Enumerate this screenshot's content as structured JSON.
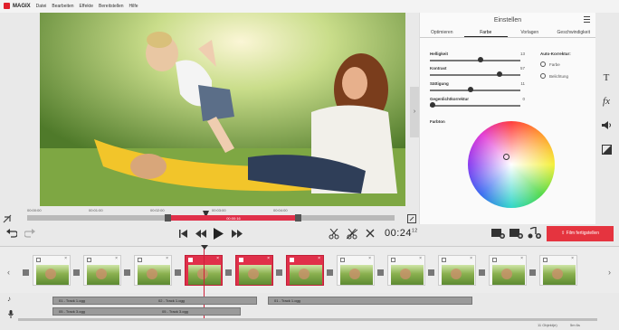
{
  "app": {
    "logo": "MAGIX",
    "menu": [
      "Datei",
      "Bearbeiten",
      "Effekte",
      "Bereitstellen",
      "Hilfe"
    ]
  },
  "preview": {
    "ruler_ticks": [
      "00:00:00",
      "00:01:00",
      "00:02:00",
      "00:03:00",
      "00:04:00"
    ],
    "selection_label": "00:00:16"
  },
  "panel": {
    "title": "Einstellen",
    "tabs": [
      "Optimieren",
      "Farbe",
      "Vorlagen",
      "Geschwindigkeit"
    ],
    "active_tab": "Farbe",
    "sliders": [
      {
        "label": "Helligkeit",
        "value": "13",
        "level": 0.56
      },
      {
        "label": "Kontrast",
        "value": "57",
        "level": 0.79
      },
      {
        "label": "Sättigung",
        "value": "11",
        "level": 0.45
      },
      {
        "label": "Gegenlichtkorrektur",
        "value": "0",
        "level": 0.0
      }
    ],
    "auto_correction": {
      "heading": "Auto-Korrektur:",
      "items": [
        "Farbe",
        "Belichtung"
      ]
    },
    "farbton_label": "Farbton"
  },
  "side_tools": [
    "text-icon",
    "fx-icon",
    "audio-icon",
    "crop-icon"
  ],
  "transport": {
    "timecode": "00:24",
    "timecode_frames": "12",
    "export_label": "Film fertigstellen"
  },
  "storyboard": {
    "clips": [
      {
        "selected": false
      },
      {
        "selected": false
      },
      {
        "selected": false
      },
      {
        "selected": true
      },
      {
        "selected": true
      },
      {
        "selected": true
      },
      {
        "selected": false
      },
      {
        "selected": false
      },
      {
        "selected": false
      },
      {
        "selected": false
      },
      {
        "selected": false
      },
      {
        "selected": false
      }
    ]
  },
  "audio_tracks": [
    {
      "label_a": "01 - Track 1.ogg",
      "label_b": "02 - Track 1.ogg"
    },
    {
      "label_a": "01 - Track 1.ogg"
    },
    {
      "label_a": "05 - Track 3.ogg",
      "label_b": "05 - Track 3.ogg"
    }
  ],
  "status": {
    "left": "11 Objekt(e)",
    "right": "5m 6s"
  },
  "colors": {
    "accent": "#e0304a",
    "export": "#e5343f",
    "panel_bg": "#fafafa",
    "app_bg": "#e9e9e9"
  }
}
